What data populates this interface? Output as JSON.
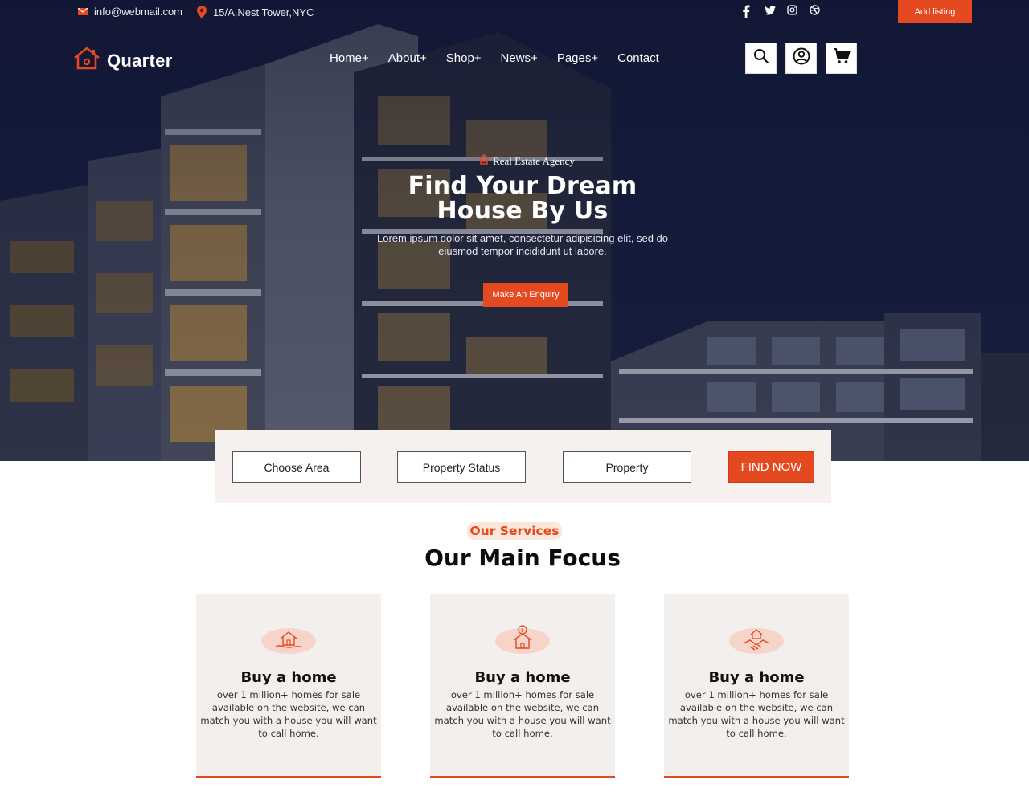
{
  "topbar": {
    "email": "info@webmail.com",
    "address": "15/A,Nest Tower,NYC",
    "social_icons": [
      "facebook-icon",
      "twitter-icon",
      "instagram-icon",
      "dribbble-icon"
    ],
    "add_listing_label": "Add listing"
  },
  "brand": {
    "name": "Quarter",
    "accent": "#e4491f"
  },
  "nav": {
    "items": [
      "Home+",
      "About+",
      "Shop+",
      "News+",
      "Pages+",
      "Contact"
    ]
  },
  "header_icons": [
    "search-icon",
    "user-icon",
    "cart-icon"
  ],
  "hero": {
    "eyebrow": "Real Estate Agency",
    "title_line1": "Find Your Dream",
    "title_line2": "House By Us",
    "description": "Lorem ipsum dolor sit amet, consectetur adipisicing elit, sed do eiusmod tempor incididunt ut labore.",
    "cta_label": "Make An Enquiry"
  },
  "search": {
    "area": "Choose Area",
    "status": "Property Status",
    "property": "Property",
    "find_label": "FIND NOW"
  },
  "services": {
    "eyebrow": "Our Services",
    "title": "Our Main Focus",
    "cards": [
      {
        "icon": "house-hand-icon",
        "title": "Buy a home",
        "desc": "over 1 million+ homes for sale available on the website, we can match you with a house you will want to call home."
      },
      {
        "icon": "house-dollar-icon",
        "title": "Buy a home",
        "desc": "over 1 million+ homes for sale available on the website, we can match you with a house you will want to call home."
      },
      {
        "icon": "handshake-house-icon",
        "title": "Buy a home",
        "desc": "over 1 million+ homes for sale available on the website, we can match you with a house you will want to call home."
      }
    ]
  }
}
